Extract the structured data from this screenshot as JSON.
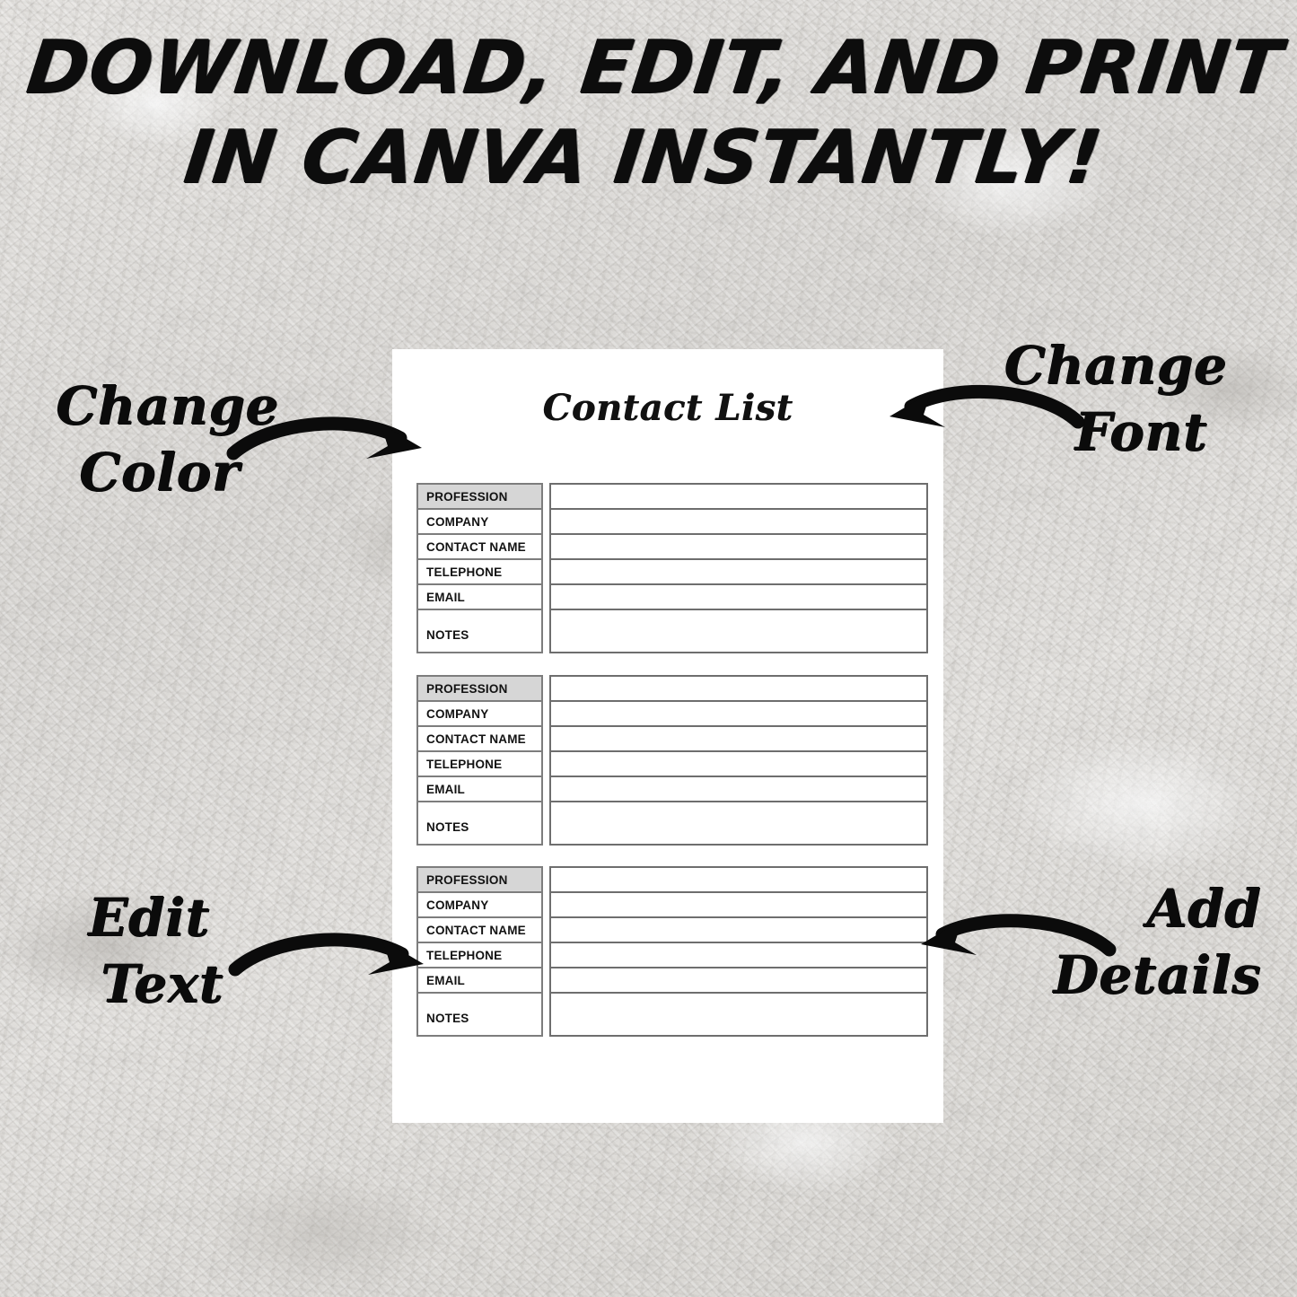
{
  "headline": {
    "line1": "DOWNLOAD, EDIT, AND PRINT",
    "line2": "IN CANVA INSTANTLY!"
  },
  "sheet": {
    "title": "Contact List",
    "row_labels": [
      "PROFESSION",
      "COMPANY",
      "CONTACT NAME",
      "TELEPHONE",
      "EMAIL",
      "NOTES"
    ],
    "blocks": [
      {
        "id": "contact-block-1",
        "rows": [
          {
            "label": "PROFESSION",
            "value": ""
          },
          {
            "label": "COMPANY",
            "value": ""
          },
          {
            "label": "CONTACT NAME",
            "value": ""
          },
          {
            "label": "TELEPHONE",
            "value": ""
          },
          {
            "label": "EMAIL",
            "value": ""
          },
          {
            "label": "NOTES",
            "value": ""
          }
        ]
      },
      {
        "id": "contact-block-2",
        "rows": [
          {
            "label": "PROFESSION",
            "value": ""
          },
          {
            "label": "COMPANY",
            "value": ""
          },
          {
            "label": "CONTACT NAME",
            "value": ""
          },
          {
            "label": "TELEPHONE",
            "value": ""
          },
          {
            "label": "EMAIL",
            "value": ""
          },
          {
            "label": "NOTES",
            "value": ""
          }
        ]
      },
      {
        "id": "contact-block-3",
        "rows": [
          {
            "label": "PROFESSION",
            "value": ""
          },
          {
            "label": "COMPANY",
            "value": ""
          },
          {
            "label": "CONTACT NAME",
            "value": ""
          },
          {
            "label": "TELEPHONE",
            "value": ""
          },
          {
            "label": "EMAIL",
            "value": ""
          },
          {
            "label": "NOTES",
            "value": ""
          }
        ]
      }
    ]
  },
  "annotations": {
    "change_color": {
      "line1": "Change",
      "line2": "Color",
      "arrow": "curved-arrow-right-icon"
    },
    "change_font": {
      "line1": "Change",
      "line2": "Font",
      "arrow": "curved-arrow-left-icon"
    },
    "edit_text": {
      "line1": "Edit",
      "line2": "Text",
      "arrow": "curved-arrow-right-icon"
    },
    "add_details": {
      "line1": "Add",
      "line2": "Details",
      "arrow": "curved-arrow-left-icon"
    }
  },
  "colors": {
    "background": "#e8e6e3",
    "sheet": "#ffffff",
    "header_fill": "#d6d6d6",
    "border": "#6e6e6e",
    "ink": "#0b0b0b"
  }
}
